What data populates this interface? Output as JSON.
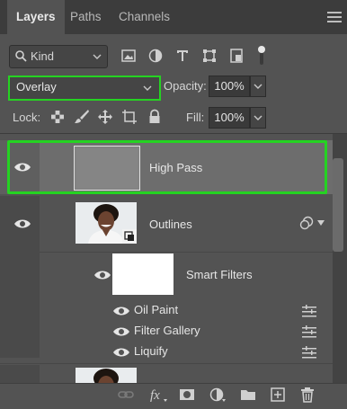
{
  "tabs": [
    {
      "label": "Layers",
      "active": true
    },
    {
      "label": "Paths",
      "active": false
    },
    {
      "label": "Channels",
      "active": false
    }
  ],
  "filter": {
    "kind_label": "Kind"
  },
  "blend": {
    "mode": "Overlay",
    "opacity_label": "Opacity:",
    "opacity_value": "100%"
  },
  "lock": {
    "label": "Lock:",
    "fill_label": "Fill:",
    "fill_value": "100%"
  },
  "layers": [
    {
      "name": "High Pass",
      "selected": true
    },
    {
      "name": "Outlines",
      "smart_object": true
    },
    {
      "name": "Smart Filters"
    },
    {
      "filters": [
        "Oil Paint",
        "Filter Gallery",
        "Liquify"
      ]
    }
  ],
  "colors": {
    "highlight": "#25d322",
    "panel": "#535353",
    "selected_row": "#6b6b6b"
  },
  "icons": [
    "search-icon",
    "image-filter-icon",
    "adjustment-filter-icon",
    "type-filter-icon",
    "shape-filter-icon",
    "smart-object-filter-icon",
    "lock-pixels-icon",
    "brush-icon",
    "move-icon",
    "artboard-icon",
    "lock-all-icon",
    "eye-icon",
    "link-icon",
    "fx-icon",
    "mask-icon",
    "adjustment-icon",
    "folder-icon",
    "new-layer-icon",
    "trash-icon"
  ]
}
